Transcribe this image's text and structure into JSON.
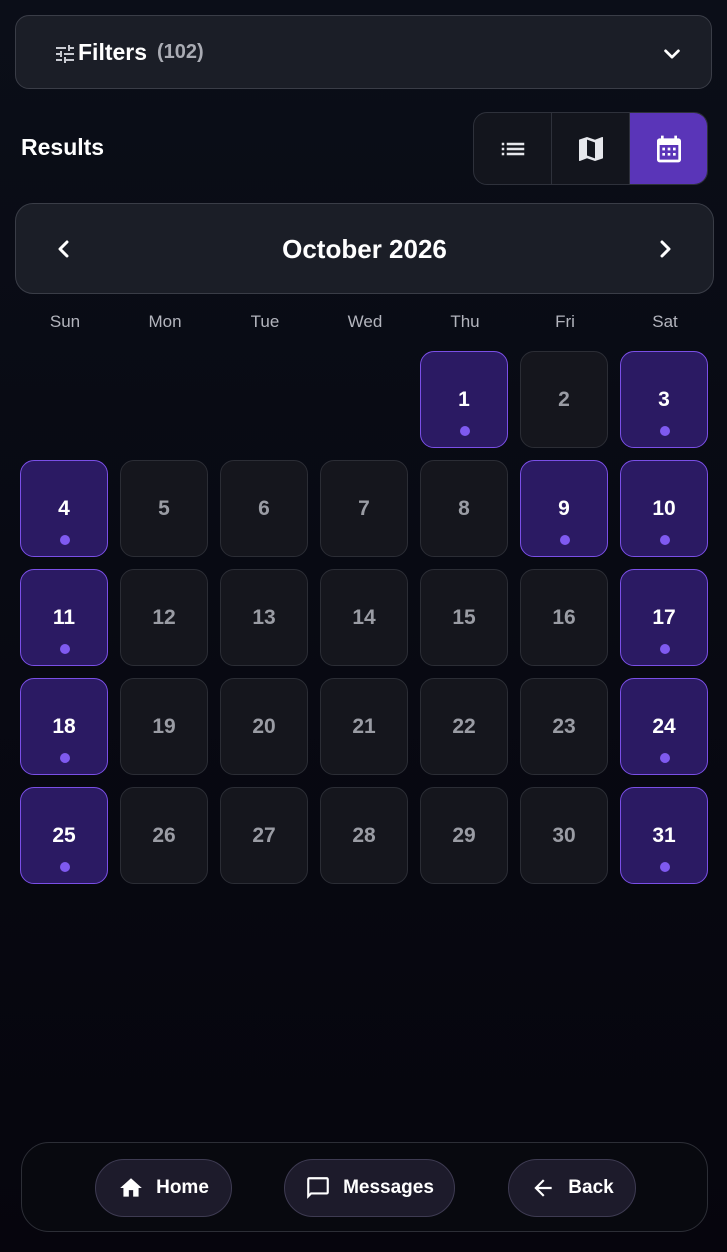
{
  "filters": {
    "label": "Filters",
    "count": "(102)",
    "icon": "tune-icon",
    "expand_icon": "chevron-down-icon"
  },
  "results": {
    "title": "Results",
    "views": [
      {
        "name": "list",
        "icon": "list-icon",
        "active": false
      },
      {
        "name": "map",
        "icon": "map-icon",
        "active": false
      },
      {
        "name": "calendar",
        "icon": "calendar-icon",
        "active": true
      }
    ]
  },
  "calendar": {
    "month_label": "October 2026",
    "weekdays": [
      "Sun",
      "Mon",
      "Tue",
      "Wed",
      "Thu",
      "Fri",
      "Sat"
    ],
    "leading_blanks": 4,
    "days": [
      {
        "day": "1",
        "event": true
      },
      {
        "day": "2",
        "event": false
      },
      {
        "day": "3",
        "event": true
      },
      {
        "day": "4",
        "event": true
      },
      {
        "day": "5",
        "event": false
      },
      {
        "day": "6",
        "event": false
      },
      {
        "day": "7",
        "event": false
      },
      {
        "day": "8",
        "event": false
      },
      {
        "day": "9",
        "event": true
      },
      {
        "day": "10",
        "event": true
      },
      {
        "day": "11",
        "event": true
      },
      {
        "day": "12",
        "event": false
      },
      {
        "day": "13",
        "event": false
      },
      {
        "day": "14",
        "event": false
      },
      {
        "day": "15",
        "event": false
      },
      {
        "day": "16",
        "event": false
      },
      {
        "day": "17",
        "event": true
      },
      {
        "day": "18",
        "event": true
      },
      {
        "day": "19",
        "event": false
      },
      {
        "day": "20",
        "event": false
      },
      {
        "day": "21",
        "event": false
      },
      {
        "day": "22",
        "event": false
      },
      {
        "day": "23",
        "event": false
      },
      {
        "day": "24",
        "event": true
      },
      {
        "day": "25",
        "event": true
      },
      {
        "day": "26",
        "event": false
      },
      {
        "day": "27",
        "event": false
      },
      {
        "day": "28",
        "event": false
      },
      {
        "day": "29",
        "event": false
      },
      {
        "day": "30",
        "event": false
      },
      {
        "day": "31",
        "event": true
      }
    ]
  },
  "bottom_nav": {
    "home": {
      "label": "Home",
      "icon": "home-icon"
    },
    "messages": {
      "label": "Messages",
      "icon": "chat-bubble-icon"
    },
    "back": {
      "label": "Back",
      "icon": "arrow-left-icon"
    }
  },
  "colors": {
    "accent": "#5a35b8",
    "event_cell": "#2b1a63",
    "event_border": "#7a4fe6",
    "event_dot": "#7f5af0",
    "background": "#0b0e18"
  }
}
